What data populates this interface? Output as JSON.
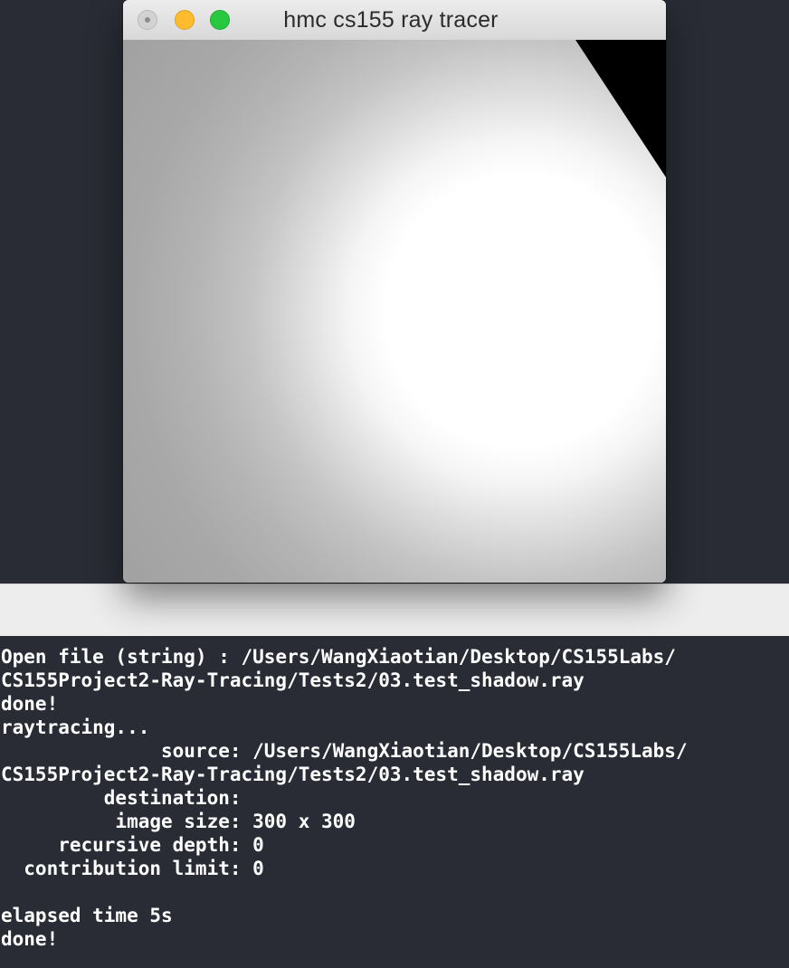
{
  "window": {
    "title": "hmc cs155 ray tracer"
  },
  "colors": {
    "background": "#292c35",
    "shelf": "#ededed",
    "close": "#d2d2d2",
    "minimize": "#febc2e",
    "zoom": "#28c840",
    "terminal_text": "#ffffff"
  },
  "icons": {
    "close": "close-icon",
    "minimize": "minimize-icon",
    "zoom": "zoom-icon"
  },
  "terminal": {
    "lines": [
      "Open file (string) : /Users/WangXiaotian/Desktop/CS155Labs/",
      "CS155Project2-Ray-Tracing/Tests2/03.test_shadow.ray",
      "done!",
      "raytracing...",
      "              source: /Users/WangXiaotian/Desktop/CS155Labs/",
      "CS155Project2-Ray-Tracing/Tests2/03.test_shadow.ray",
      "         destination: ",
      "          image size: 300 x 300",
      "     recursive depth: 0",
      "  contribution limit: 0",
      "",
      "elapsed time 5s",
      "done!"
    ]
  }
}
